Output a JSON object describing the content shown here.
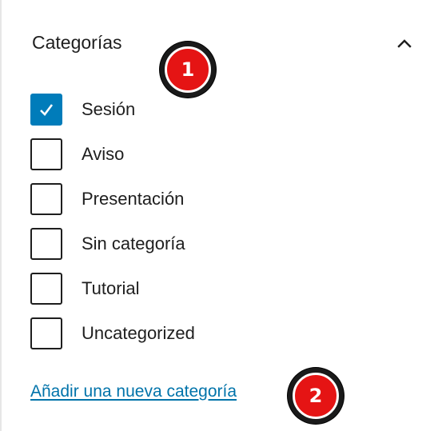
{
  "panel": {
    "title": "Categorías",
    "collapse_icon": "chevron-up-icon"
  },
  "categories": [
    {
      "label": "Sesión",
      "checked": true
    },
    {
      "label": "Aviso",
      "checked": false
    },
    {
      "label": "Presentación",
      "checked": false
    },
    {
      "label": "Sin categoría",
      "checked": false
    },
    {
      "label": "Tutorial",
      "checked": false
    },
    {
      "label": "Uncategorized",
      "checked": false
    }
  ],
  "add_link": "Añadir una nueva categoría",
  "badges": [
    {
      "number": "1"
    },
    {
      "number": "2"
    }
  ],
  "colors": {
    "accent": "#007cba",
    "link": "#0073aa",
    "badge": "#e51414"
  }
}
